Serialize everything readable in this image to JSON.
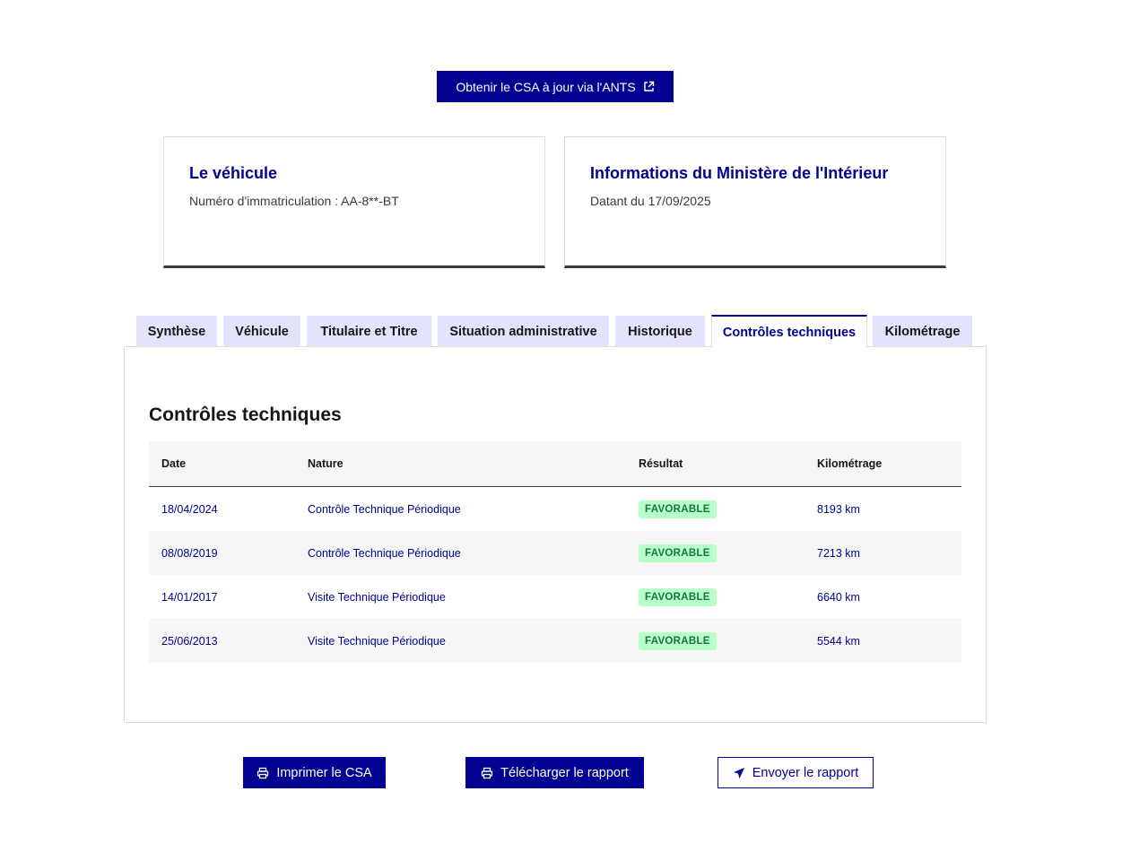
{
  "top_action": {
    "label": "Obtenir le CSA à jour via l'ANTS",
    "icon": "external-link-icon"
  },
  "vehicle_card": {
    "title": "Le véhicule",
    "text": "Numéro d'immatriculation : AA-8**-BT"
  },
  "ministry_card": {
    "title": "Informations du Ministère de l'Intérieur",
    "text": "Datant du 17/09/2025"
  },
  "tabs": [
    {
      "label": "Synthèse",
      "active": false
    },
    {
      "label": "Véhicule",
      "active": false
    },
    {
      "label": "Titulaire et Titre",
      "active": false
    },
    {
      "label": "Situation administrative",
      "active": false
    },
    {
      "label": "Historique",
      "active": false
    },
    {
      "label": "Contrôles techniques",
      "active": true
    },
    {
      "label": "Kilométrage",
      "active": false
    }
  ],
  "panel": {
    "title": "Contrôles techniques",
    "columns": [
      "Date",
      "Nature",
      "Résultat",
      "Kilométrage"
    ],
    "rows": [
      {
        "date": "18/04/2024",
        "nature": "Contrôle Technique Périodique",
        "result": "FAVORABLE",
        "km": "8193 km"
      },
      {
        "date": "08/08/2019",
        "nature": "Contrôle Technique Périodique",
        "result": "FAVORABLE",
        "km": "7213 km"
      },
      {
        "date": "14/01/2017",
        "nature": "Visite Technique Périodique",
        "result": "FAVORABLE",
        "km": "6640 km"
      },
      {
        "date": "25/06/2013",
        "nature": "Visite Technique Périodique",
        "result": "FAVORABLE",
        "km": "5544 km"
      }
    ]
  },
  "actions": {
    "print": {
      "label": "Imprimer le CSA",
      "icon": "printer-icon"
    },
    "download": {
      "label": "Télécharger le rapport",
      "icon": "printer-icon"
    },
    "send": {
      "label": "Envoyer le rapport",
      "icon": "send-icon"
    }
  },
  "colors": {
    "primary": "#000091",
    "tab_bg": "#e3e3fd",
    "success_bg": "#b8fec9",
    "success_text": "#18753c",
    "row_alt": "#f6f6f6"
  }
}
